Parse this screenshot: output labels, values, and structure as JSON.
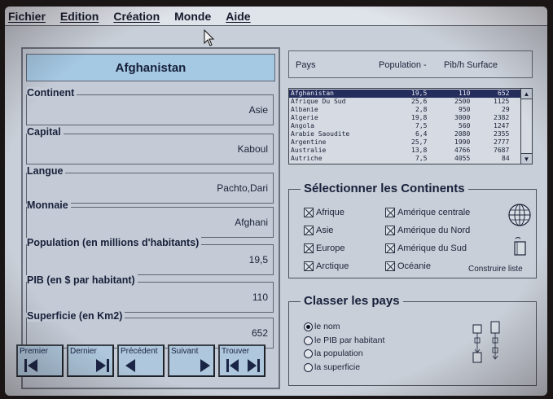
{
  "menu": [
    "Fichier",
    "Edition",
    "Création",
    "Monde",
    "Aide"
  ],
  "country": {
    "name": "Afghanistan",
    "fields": [
      {
        "label": "Continent",
        "value": "Asie"
      },
      {
        "label": "Capital",
        "value": "Kaboul"
      },
      {
        "label": "Langue",
        "value": "Pachto,Dari"
      },
      {
        "label": "Monnaie",
        "value": "Afghani"
      },
      {
        "label": "Population (en millions d'habitants)",
        "value": "19,5"
      },
      {
        "label": "PIB (en $ par habitant)",
        "value": "110"
      },
      {
        "label": "Superficie (en Km2)",
        "value": "652"
      }
    ]
  },
  "nav": [
    "Premier",
    "Dernier",
    "Précédent",
    "Suivant",
    "Trouver"
  ],
  "list": {
    "headers": {
      "pays": "Pays",
      "population": "Population -",
      "pib_surface": "Pib/h Surface"
    },
    "rows": [
      [
        "Afghanistan",
        "19,5",
        "110",
        "652"
      ],
      [
        "Afrique Du Sud",
        "25,6",
        "2500",
        "1125"
      ],
      [
        "Albanie",
        "2,8",
        "950",
        "29"
      ],
      [
        "Algerie",
        "19,8",
        "3000",
        "2382"
      ],
      [
        "Angola",
        "7,5",
        "560",
        "1247"
      ],
      [
        "Arabie Saoudite",
        "6,4",
        "2080",
        "2355"
      ],
      [
        "Argentine",
        "25,7",
        "1990",
        "2777"
      ],
      [
        "Australie",
        "13,8",
        "4766",
        "7687"
      ],
      [
        "Autriche",
        "7,5",
        "4055",
        "84"
      ]
    ],
    "selected_index": 0
  },
  "continents": {
    "title": "Sélectionner les Continents",
    "left": [
      "Afrique",
      "Asie",
      "Europe",
      "Arctique"
    ],
    "right": [
      "Amérique centrale",
      "Amérique du Nord",
      "Amérique du Sud",
      "Océanie"
    ],
    "build_label": "Construire liste"
  },
  "sort": {
    "title": "Classer les pays",
    "options": [
      "le nom",
      "le PIB par habitant",
      "la population",
      "la superficie"
    ],
    "selected_index": 0
  }
}
